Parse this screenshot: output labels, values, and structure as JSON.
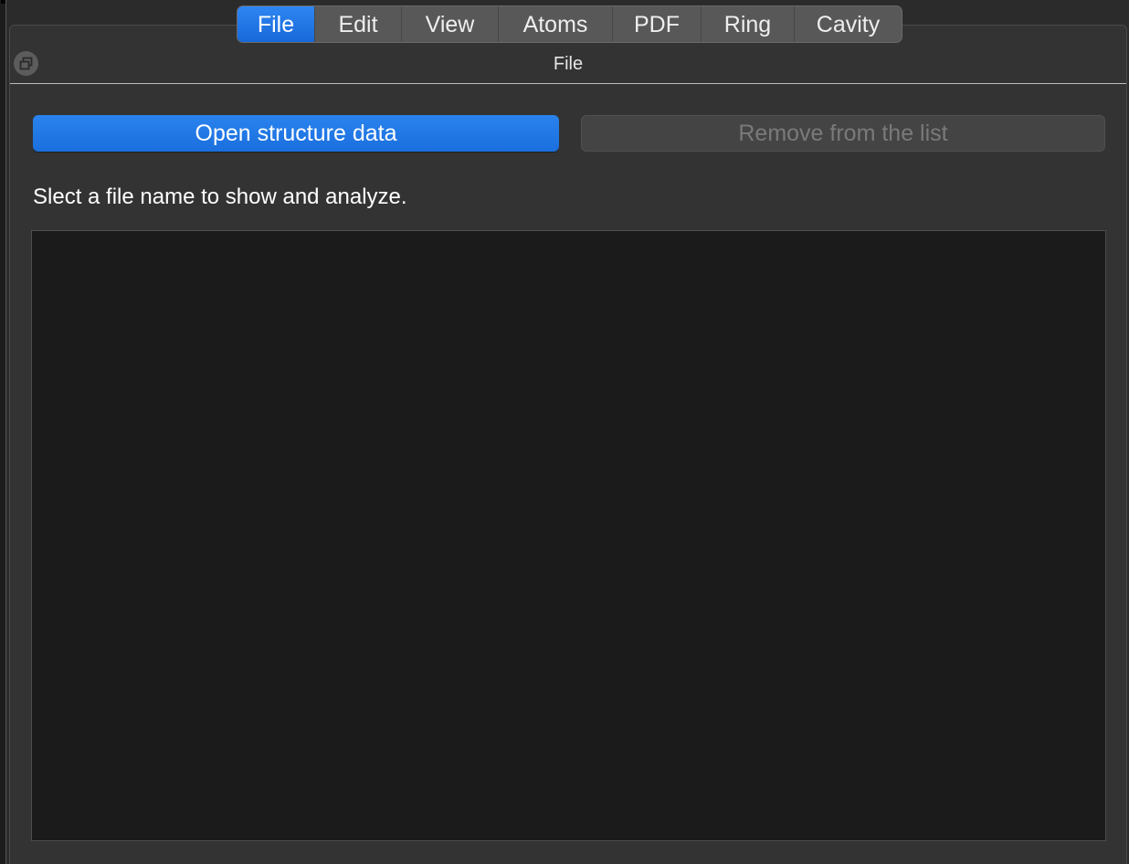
{
  "tabs": [
    {
      "label": "File",
      "active": true
    },
    {
      "label": "Edit",
      "active": false
    },
    {
      "label": "View",
      "active": false
    },
    {
      "label": "Atoms",
      "active": false
    },
    {
      "label": "PDF",
      "active": false
    },
    {
      "label": "Ring",
      "active": false
    },
    {
      "label": "Cavity",
      "active": false
    }
  ],
  "panel": {
    "title": "File",
    "float_icon": "restore-window-icon"
  },
  "actions": {
    "open_label": "Open structure data",
    "remove_label": "Remove from the list"
  },
  "hint": "Slect a file name to show and analyze.",
  "file_list": {
    "items": []
  },
  "colors": {
    "accent": "#1a6fdd",
    "panel_bg": "#333333",
    "list_bg": "#1b1b1b",
    "disabled_text": "#7a7a7a"
  }
}
